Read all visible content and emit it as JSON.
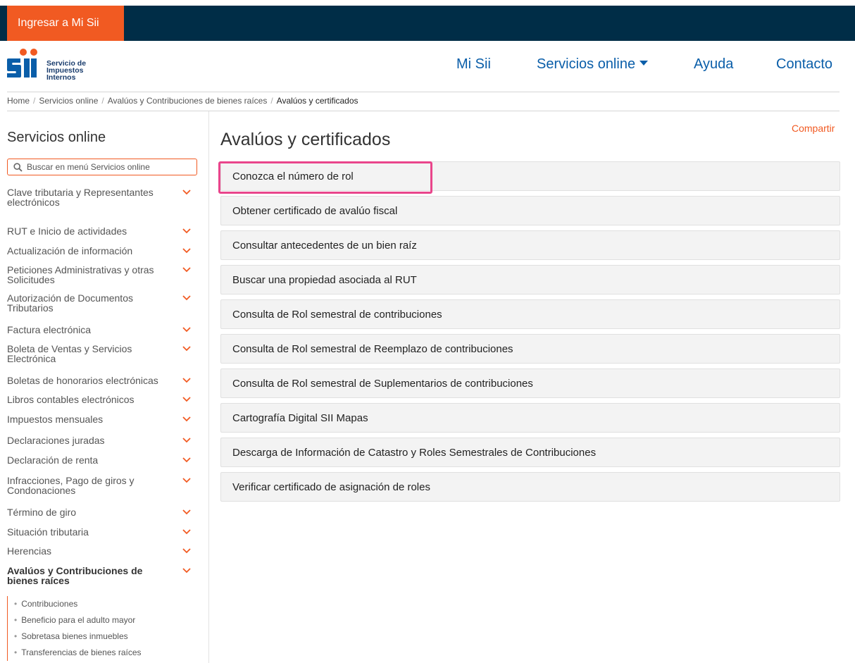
{
  "topbar": {
    "login_button": "Ingresar a Mi Sii"
  },
  "logo": {
    "line1": "Servicio de",
    "line2": "Impuestos",
    "line3": "Internos"
  },
  "nav": {
    "mi_sii": "Mi Sii",
    "servicios": "Servicios online",
    "ayuda": "Ayuda",
    "contacto": "Contacto"
  },
  "breadcrumb": [
    "Home",
    "Servicios online",
    "Avalúos y Contribuciones de bienes raíces",
    "Avalúos y certificados"
  ],
  "sidebar": {
    "title": "Servicios online",
    "search_placeholder": "Buscar en menú Servicios online",
    "items": [
      "Clave tributaria y Representantes electrónicos",
      "RUT e Inicio de actividades",
      "Actualización de información",
      "Peticiones Administrativas y otras Solicitudes",
      "Autorización de Documentos Tributarios",
      "Factura electrónica",
      "Boleta de Ventas y Servicios Electrónica",
      "Boletas de honorarios electrónicas",
      "Libros contables electrónicos",
      "Impuestos mensuales",
      "Declaraciones juradas",
      "Declaración de renta",
      "Infracciones, Pago de giros y Condonaciones",
      "Término de giro",
      "Situación tributaria",
      "Herencias",
      "Avalúos y Contribuciones de bienes raíces"
    ],
    "subitems": [
      "Contribuciones",
      "Beneficio para el adulto mayor",
      "Sobretasa bienes inmuebles",
      "Transferencias de bienes raíces"
    ]
  },
  "main": {
    "share": "Compartir",
    "title": "Avalúos y certificados",
    "items": [
      "Conozca el número de rol",
      "Obtener certificado de avalúo fiscal",
      "Consultar antecedentes de un bien raíz",
      "Buscar una propiedad asociada al RUT",
      "Consulta de Rol semestral de contribuciones",
      "Consulta de Rol semestral de Reemplazo de contribuciones",
      "Consulta de Rol semestral de Suplementarios de contribuciones",
      "Cartografía Digital SII Mapas",
      "Descarga de Información de Catastro y Roles Semestrales de Contribuciones",
      "Verificar certificado de asignación de roles"
    ]
  },
  "colors": {
    "topbar": "#002d47",
    "accent": "#f15a22",
    "nav_blue": "#0a5ea9",
    "highlight": "#e9458b"
  }
}
